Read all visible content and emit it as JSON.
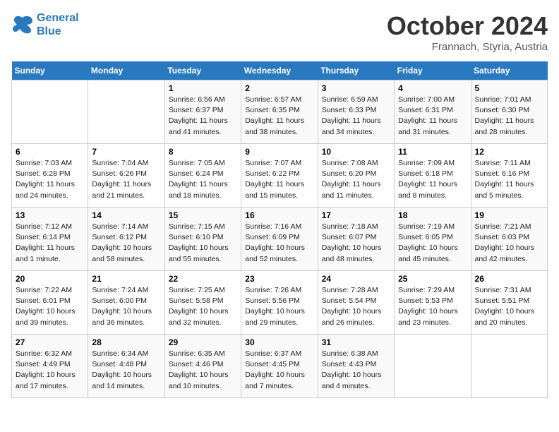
{
  "header": {
    "logo_line1": "General",
    "logo_line2": "Blue",
    "month": "October 2024",
    "location": "Frannach, Styria, Austria"
  },
  "weekdays": [
    "Sunday",
    "Monday",
    "Tuesday",
    "Wednesday",
    "Thursday",
    "Friday",
    "Saturday"
  ],
  "weeks": [
    [
      {
        "day": "",
        "info": ""
      },
      {
        "day": "",
        "info": ""
      },
      {
        "day": "1",
        "info": "Sunrise: 6:56 AM\nSunset: 6:37 PM\nDaylight: 11 hours\nand 41 minutes."
      },
      {
        "day": "2",
        "info": "Sunrise: 6:57 AM\nSunset: 6:35 PM\nDaylight: 11 hours\nand 38 minutes."
      },
      {
        "day": "3",
        "info": "Sunrise: 6:59 AM\nSunset: 6:33 PM\nDaylight: 11 hours\nand 34 minutes."
      },
      {
        "day": "4",
        "info": "Sunrise: 7:00 AM\nSunset: 6:31 PM\nDaylight: 11 hours\nand 31 minutes."
      },
      {
        "day": "5",
        "info": "Sunrise: 7:01 AM\nSunset: 6:30 PM\nDaylight: 11 hours\nand 28 minutes."
      }
    ],
    [
      {
        "day": "6",
        "info": "Sunrise: 7:03 AM\nSunset: 6:28 PM\nDaylight: 11 hours\nand 24 minutes."
      },
      {
        "day": "7",
        "info": "Sunrise: 7:04 AM\nSunset: 6:26 PM\nDaylight: 11 hours\nand 21 minutes."
      },
      {
        "day": "8",
        "info": "Sunrise: 7:05 AM\nSunset: 6:24 PM\nDaylight: 11 hours\nand 18 minutes."
      },
      {
        "day": "9",
        "info": "Sunrise: 7:07 AM\nSunset: 6:22 PM\nDaylight: 11 hours\nand 15 minutes."
      },
      {
        "day": "10",
        "info": "Sunrise: 7:08 AM\nSunset: 6:20 PM\nDaylight: 11 hours\nand 11 minutes."
      },
      {
        "day": "11",
        "info": "Sunrise: 7:09 AM\nSunset: 6:18 PM\nDaylight: 11 hours\nand 8 minutes."
      },
      {
        "day": "12",
        "info": "Sunrise: 7:11 AM\nSunset: 6:16 PM\nDaylight: 11 hours\nand 5 minutes."
      }
    ],
    [
      {
        "day": "13",
        "info": "Sunrise: 7:12 AM\nSunset: 6:14 PM\nDaylight: 11 hours\nand 1 minute."
      },
      {
        "day": "14",
        "info": "Sunrise: 7:14 AM\nSunset: 6:12 PM\nDaylight: 10 hours\nand 58 minutes."
      },
      {
        "day": "15",
        "info": "Sunrise: 7:15 AM\nSunset: 6:10 PM\nDaylight: 10 hours\nand 55 minutes."
      },
      {
        "day": "16",
        "info": "Sunrise: 7:16 AM\nSunset: 6:09 PM\nDaylight: 10 hours\nand 52 minutes."
      },
      {
        "day": "17",
        "info": "Sunrise: 7:18 AM\nSunset: 6:07 PM\nDaylight: 10 hours\nand 48 minutes."
      },
      {
        "day": "18",
        "info": "Sunrise: 7:19 AM\nSunset: 6:05 PM\nDaylight: 10 hours\nand 45 minutes."
      },
      {
        "day": "19",
        "info": "Sunrise: 7:21 AM\nSunset: 6:03 PM\nDaylight: 10 hours\nand 42 minutes."
      }
    ],
    [
      {
        "day": "20",
        "info": "Sunrise: 7:22 AM\nSunset: 6:01 PM\nDaylight: 10 hours\nand 39 minutes."
      },
      {
        "day": "21",
        "info": "Sunrise: 7:24 AM\nSunset: 6:00 PM\nDaylight: 10 hours\nand 36 minutes."
      },
      {
        "day": "22",
        "info": "Sunrise: 7:25 AM\nSunset: 5:58 PM\nDaylight: 10 hours\nand 32 minutes."
      },
      {
        "day": "23",
        "info": "Sunrise: 7:26 AM\nSunset: 5:56 PM\nDaylight: 10 hours\nand 29 minutes."
      },
      {
        "day": "24",
        "info": "Sunrise: 7:28 AM\nSunset: 5:54 PM\nDaylight: 10 hours\nand 26 minutes."
      },
      {
        "day": "25",
        "info": "Sunrise: 7:29 AM\nSunset: 5:53 PM\nDaylight: 10 hours\nand 23 minutes."
      },
      {
        "day": "26",
        "info": "Sunrise: 7:31 AM\nSunset: 5:51 PM\nDaylight: 10 hours\nand 20 minutes."
      }
    ],
    [
      {
        "day": "27",
        "info": "Sunrise: 6:32 AM\nSunset: 4:49 PM\nDaylight: 10 hours\nand 17 minutes."
      },
      {
        "day": "28",
        "info": "Sunrise: 6:34 AM\nSunset: 4:48 PM\nDaylight: 10 hours\nand 14 minutes."
      },
      {
        "day": "29",
        "info": "Sunrise: 6:35 AM\nSunset: 4:46 PM\nDaylight: 10 hours\nand 10 minutes."
      },
      {
        "day": "30",
        "info": "Sunrise: 6:37 AM\nSunset: 4:45 PM\nDaylight: 10 hours\nand 7 minutes."
      },
      {
        "day": "31",
        "info": "Sunrise: 6:38 AM\nSunset: 4:43 PM\nDaylight: 10 hours\nand 4 minutes."
      },
      {
        "day": "",
        "info": ""
      },
      {
        "day": "",
        "info": ""
      }
    ]
  ]
}
